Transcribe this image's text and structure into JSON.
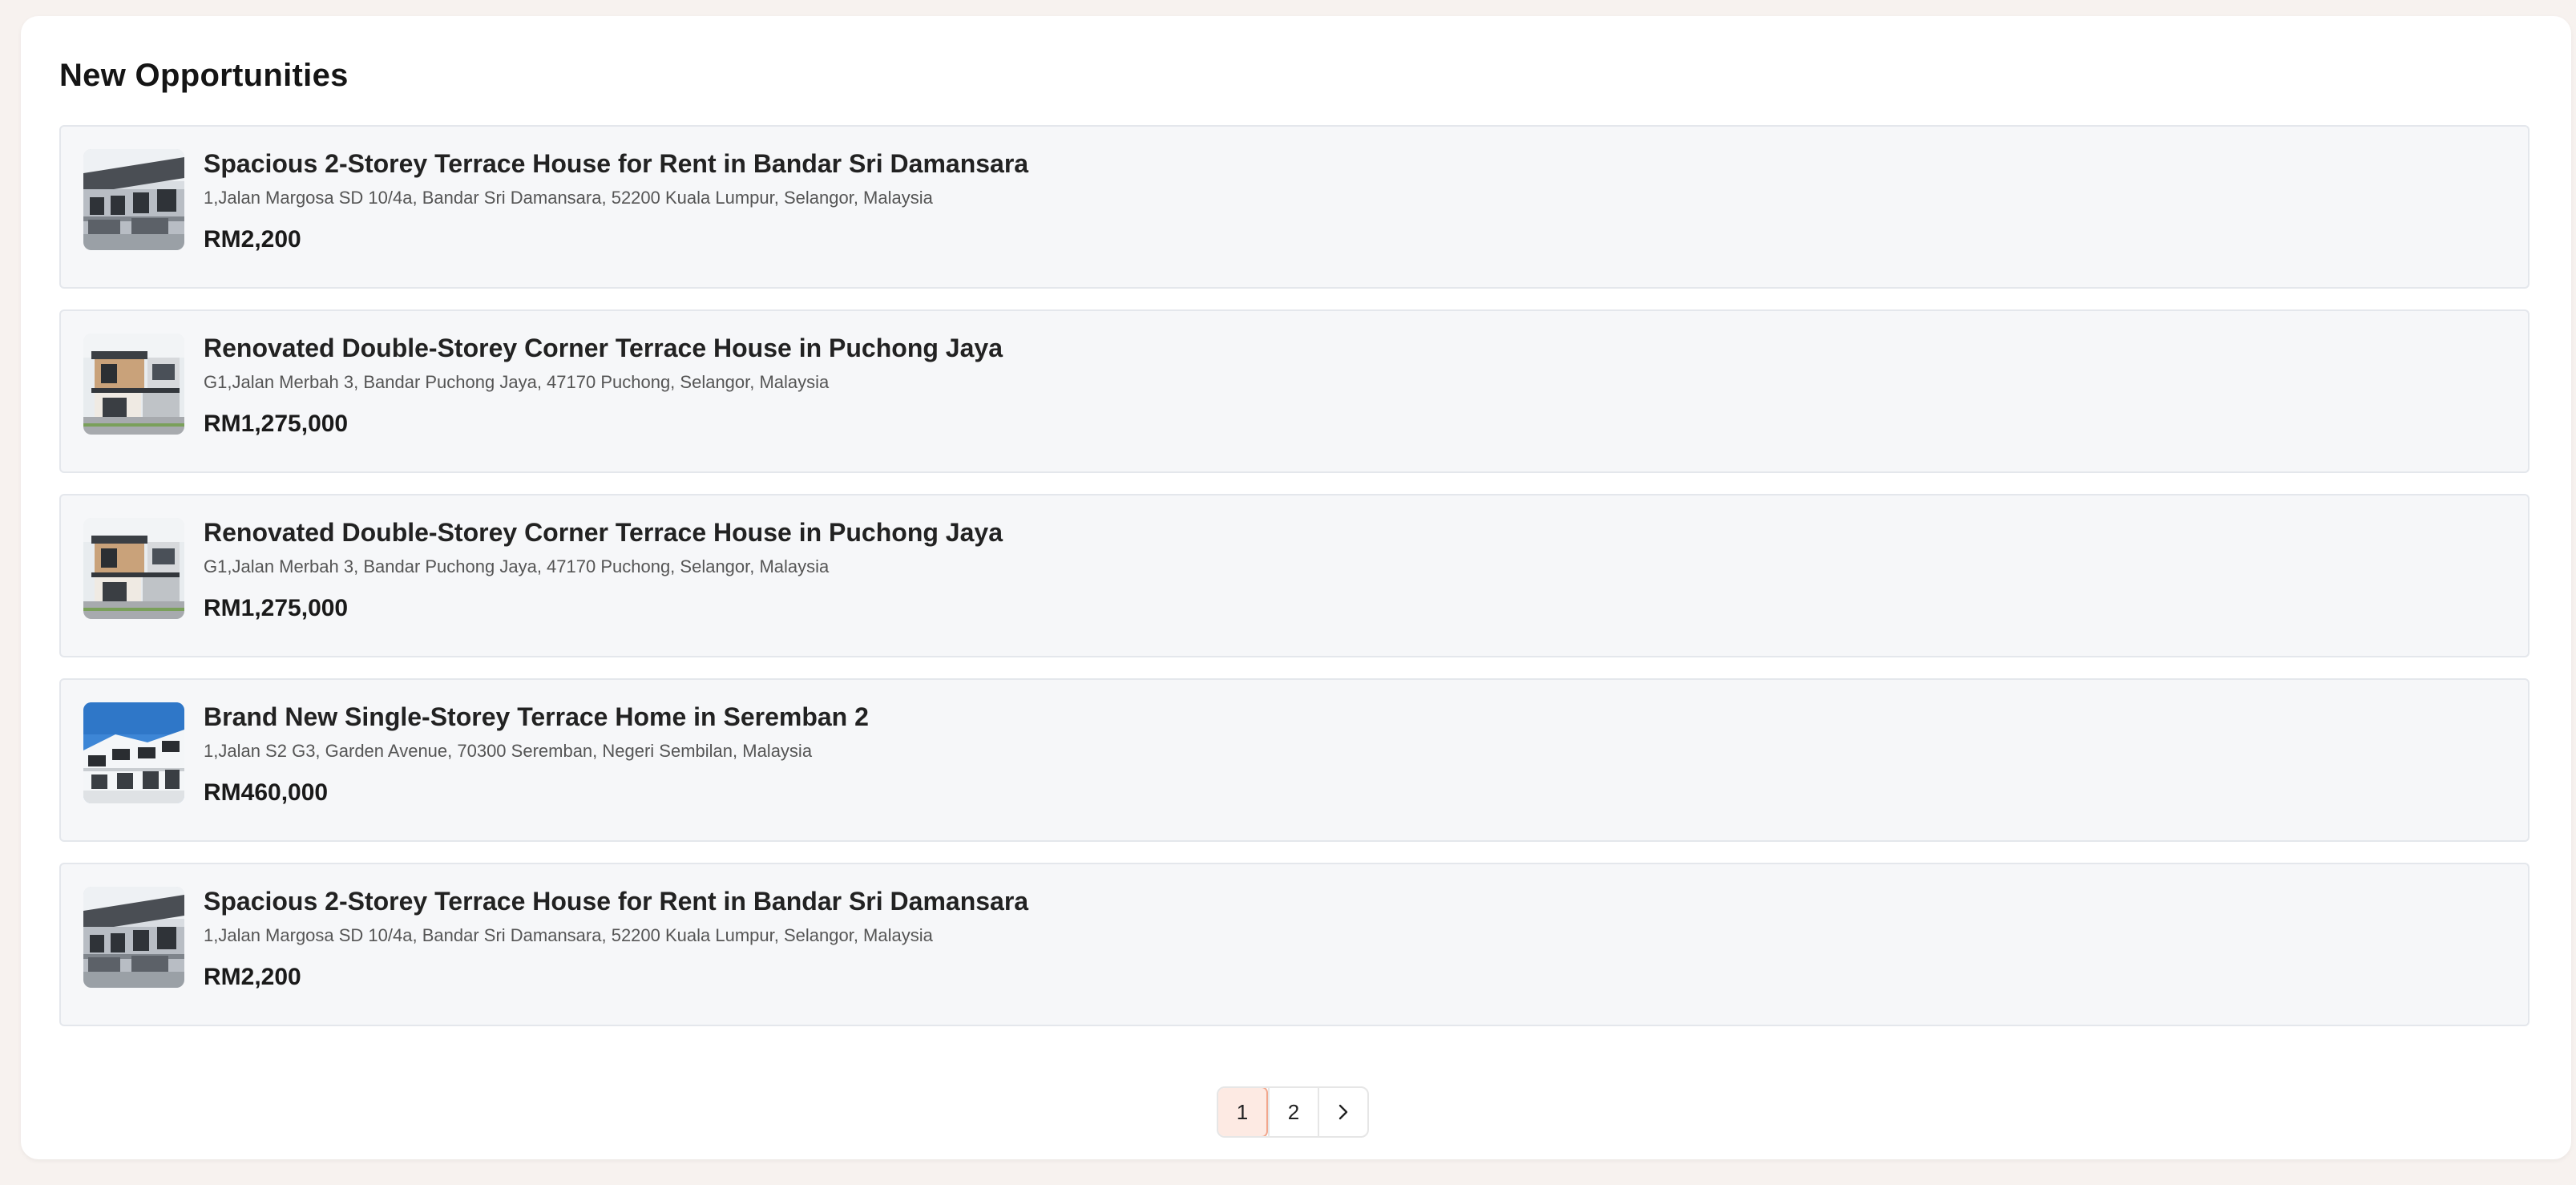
{
  "section": {
    "title": "New Opportunities"
  },
  "listings": [
    {
      "title": "Spacious 2-Storey Terrace House for Rent in Bandar Sri Damansara",
      "address": "1,Jalan Margosa SD 10/4a, Bandar Sri Damansara, 52200 Kuala Lumpur, Selangor, Malaysia",
      "price": "RM2,200",
      "image": "terrace-house-grey-photo"
    },
    {
      "title": "Renovated Double-Storey Corner Terrace House in Puchong Jaya",
      "address": "G1,Jalan Merbah 3, Bandar Puchong Jaya, 47170 Puchong, Selangor, Malaysia",
      "price": "RM1,275,000",
      "image": "modern-house-wood-photo"
    },
    {
      "title": "Renovated Double-Storey Corner Terrace House in Puchong Jaya",
      "address": "G1,Jalan Merbah 3, Bandar Puchong Jaya, 47170 Puchong, Selangor, Malaysia",
      "price": "RM1,275,000",
      "image": "modern-house-wood-photo"
    },
    {
      "title": "Brand New Single-Storey Terrace Home in Seremban 2",
      "address": "1,Jalan S2 G3, Garden Avenue, 70300 Seremban, Negeri Sembilan, Malaysia",
      "price": "RM460,000",
      "image": "white-terrace-blue-sky-photo"
    },
    {
      "title": "Spacious 2-Storey Terrace House for Rent in Bandar Sri Damansara",
      "address": "1,Jalan Margosa SD 10/4a, Bandar Sri Damansara, 52200 Kuala Lumpur, Selangor, Malaysia",
      "price": "RM2,200",
      "image": "terrace-house-grey-photo"
    }
  ],
  "pagination": {
    "pages": [
      "1",
      "2"
    ],
    "current": "1",
    "next_icon": "chevron-right-icon"
  },
  "colors": {
    "page_bg": "#f7f2ef",
    "card_bg": "#ffffff",
    "item_bg": "#f6f7f9",
    "active_page_bg": "#fdeae3",
    "active_page_border": "#f1a68c"
  }
}
